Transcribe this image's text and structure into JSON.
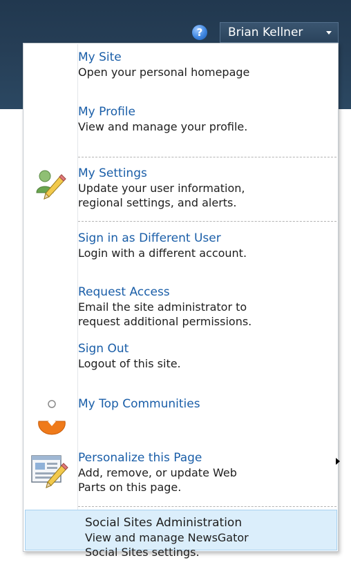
{
  "header": {
    "help_symbol": "?",
    "user_name": "Brian Kellner",
    "colors": {
      "bar": "#263e56",
      "link": "#1a5ea8",
      "highlight": "#dbeefb"
    }
  },
  "menu": {
    "items": [
      {
        "title": "My Site",
        "desc": [
          "Open your personal homepage"
        ]
      },
      {
        "title": "My Profile",
        "desc": [
          "View and manage your profile."
        ]
      },
      {
        "title": "My Settings",
        "desc": [
          "Update your user information,",
          "regional settings, and alerts."
        ],
        "icon": "user-settings-icon"
      },
      {
        "title": "Sign in as Different User",
        "desc": [
          "Login with a different account."
        ]
      },
      {
        "title": "Request Access",
        "desc": [
          "Email the site administrator to",
          "request additional permissions."
        ]
      },
      {
        "title": "Sign Out",
        "desc": [
          "Logout of this site."
        ]
      },
      {
        "title": "My Top Communities",
        "desc": [],
        "icon": "communities-icon",
        "has_submenu": true
      },
      {
        "title": "Personalize this Page",
        "desc": [
          "Add, remove, or update Web",
          "Parts on this page."
        ],
        "icon": "edit-page-icon"
      },
      {
        "title": "Social Sites Administration",
        "desc": [
          "View and manage NewsGator",
          "Social Sites settings."
        ],
        "selected": true
      }
    ]
  }
}
